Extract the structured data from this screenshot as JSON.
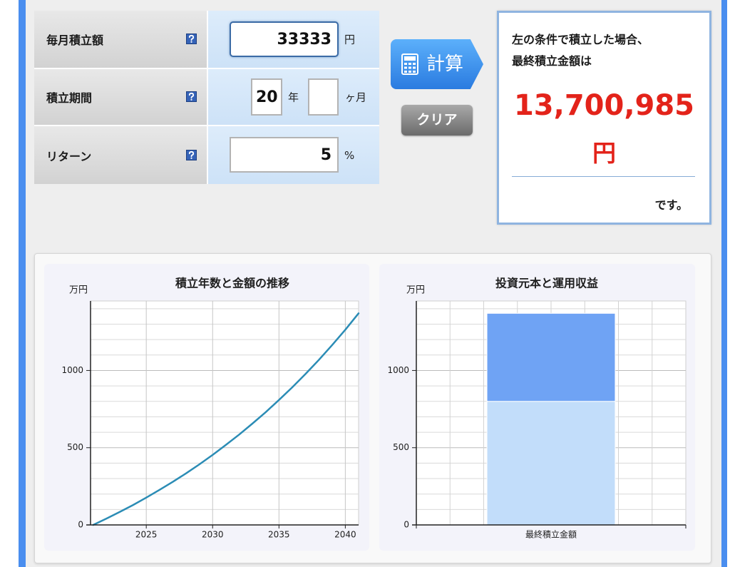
{
  "form": {
    "monthly": {
      "label": "毎月積立額",
      "value": "33333",
      "unit": "円"
    },
    "period": {
      "label": "積立期間",
      "years_value": "20",
      "years_unit": "年",
      "months_value": "",
      "months_unit": "ヶ月"
    },
    "return_rate": {
      "label": "リターン",
      "value": "5",
      "unit": "%"
    }
  },
  "buttons": {
    "calculate": "計算",
    "clear": "クリア"
  },
  "result": {
    "intro_line1": "左の条件で積立した場合、",
    "intro_line2": "最終積立金額は",
    "amount": "13,700,985",
    "currency": "円",
    "suffix": "です。"
  },
  "icons": {
    "help": "help-icon",
    "calculate": "calculator-icon"
  },
  "colors": {
    "frame_blue": "#4a8eef",
    "result_red": "#e3231a",
    "result_border": "#8fb4e0",
    "line_series": "#2b8cb5",
    "bar_principal": "#c2ddfa",
    "bar_profit": "#6fa3f4"
  },
  "chart_data": [
    {
      "type": "line",
      "title": "積立年数と金額の推移",
      "ylabel": "万円",
      "x": [
        2021,
        2022,
        2023,
        2024,
        2025,
        2026,
        2027,
        2028,
        2029,
        2030,
        2031,
        2032,
        2033,
        2034,
        2035,
        2036,
        2037,
        2038,
        2039,
        2040,
        2041
      ],
      "series": [
        {
          "values": [
            0,
            41,
            84,
            129,
            177,
            227,
            279,
            334,
            392,
            453,
            518,
            585,
            656,
            730,
            809,
            891,
            977,
            1068,
            1164,
            1264,
            1370
          ]
        }
      ],
      "xticks": [
        2025,
        2030,
        2035,
        2040
      ],
      "yticks": [
        0,
        500,
        1000
      ],
      "xlim": [
        2020.8,
        2041
      ],
      "ylim": [
        0,
        1450
      ],
      "grid": true,
      "legend": "none"
    },
    {
      "type": "bar",
      "stacked": true,
      "title": "投資元本と運用収益",
      "ylabel": "万円",
      "categories": [
        "最終積立金額"
      ],
      "series": [
        {
          "values": [
            800
          ]
        },
        {
          "values": [
            570
          ]
        }
      ],
      "yticks": [
        0,
        500,
        1000
      ],
      "ylim": [
        0,
        1450
      ],
      "grid": true,
      "legend": "none"
    }
  ]
}
